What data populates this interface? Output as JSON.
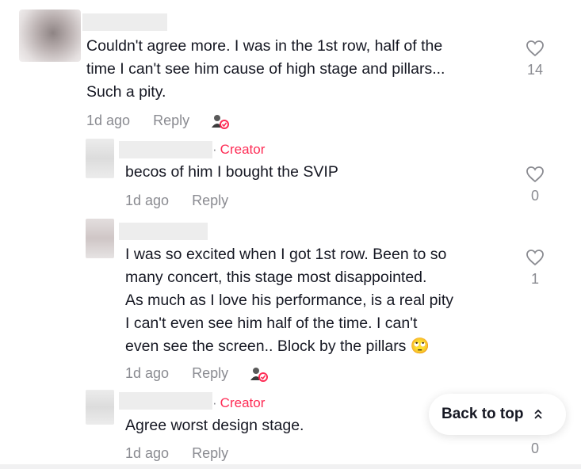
{
  "comments": [
    {
      "text_lines": [
        "Couldn't agree more. I was in the 1st row, half of the",
        "time I can't see him cause of high stage and pillars...",
        "Such a pity."
      ],
      "date": "1d ago",
      "reply_label": "Reply",
      "likes": "14"
    }
  ],
  "replies": [
    {
      "creator_label": "Creator",
      "text_lines": [
        "becos of him I bought the SVIP"
      ],
      "date": "1d ago",
      "reply_label": "Reply",
      "likes": "0"
    },
    {
      "text_lines": [
        "I was so excited when I got 1st row. Been to so",
        "many concert, this stage most disappointed.",
        "As much as I love his performance, is a real pity",
        "I can't even see him half of the time. I can't",
        "even see the screen.. Block by the pillars 🙄"
      ],
      "date": "1d ago",
      "reply_label": "Reply",
      "likes": "1"
    },
    {
      "creator_label": "Creator",
      "text_lines": [
        "Agree worst design stage."
      ],
      "date": "1d ago",
      "reply_label": "Reply",
      "likes": "0"
    }
  ],
  "back_to_top": "Back to top",
  "colors": {
    "accent": "#fe2c55",
    "muted": "#8a8b91",
    "text": "#161823"
  },
  "icons": [
    "heart-outline-icon",
    "creator-liked-icon",
    "chevron-up-double-icon"
  ]
}
